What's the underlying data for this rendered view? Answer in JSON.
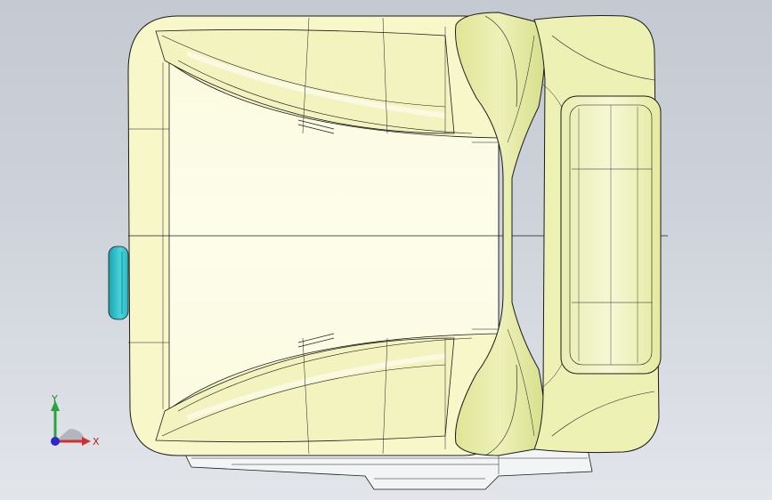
{
  "viewport": {
    "background_top": "#c4c9d2",
    "background_bottom": "#e2e5ea"
  },
  "model": {
    "shell_color": "#f7f7c9",
    "shell_inner_color": "#fbfbe3",
    "rim_color": "#e4e9a3",
    "rim_dark_color": "#cfd886",
    "knob_color": "#47d5dc",
    "knob_dark_color": "#1aa3ae",
    "edge_color": "#1b1b1b"
  },
  "triad": {
    "x_label": "X",
    "y_label": "Y",
    "x_color": "#d03030",
    "y_color": "#2aa33a",
    "z_color": "#2a2acc"
  }
}
